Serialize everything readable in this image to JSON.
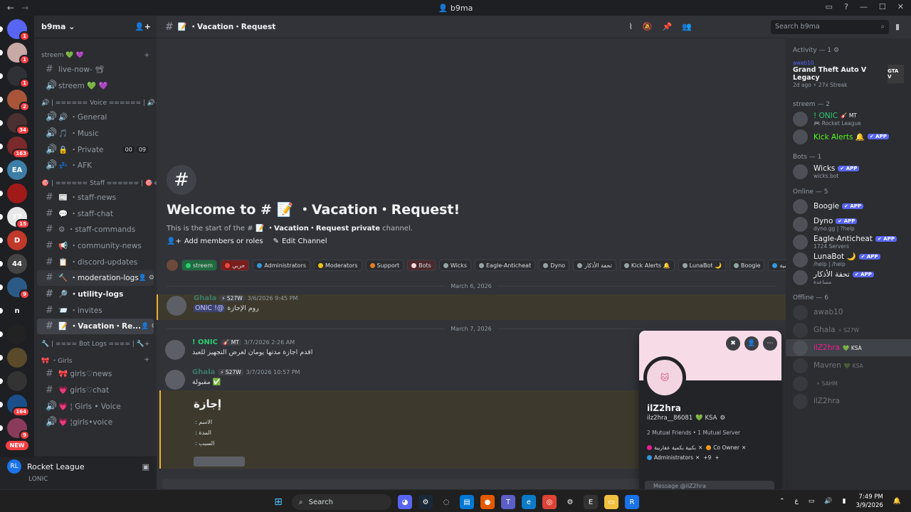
{
  "window": {
    "title": "b9ma",
    "nav_back": "←",
    "nav_forward": "→"
  },
  "servers": [
    {
      "label": "",
      "badge": "1",
      "color": "#5865f2"
    },
    {
      "label": "",
      "badge": "1",
      "color": "#c9a9a6"
    },
    {
      "label": "",
      "badge": "1",
      "color": "#2f3136"
    },
    {
      "label": "",
      "badge": "2",
      "color": "#a8553a"
    },
    {
      "label": "",
      "badge": "34",
      "color": "#4a3030"
    },
    {
      "label": "",
      "badge": "163",
      "color": "#7a2a2a"
    },
    {
      "label": "EA",
      "badge": "",
      "color": "#3d7ea6"
    },
    {
      "label": "",
      "badge": "",
      "color": "#a01a1a"
    },
    {
      "label": "77",
      "badge": "15",
      "color": "#e8e8e8"
    },
    {
      "label": "D",
      "badge": "",
      "color": "#c0392b"
    },
    {
      "label": "44",
      "badge": "",
      "color": "#444"
    },
    {
      "label": "",
      "badge": "9",
      "color": "#2c5a87"
    },
    {
      "label": "n",
      "badge": "",
      "color": "#1e1f22"
    },
    {
      "label": "",
      "badge": "",
      "color": "#222"
    },
    {
      "label": "",
      "badge": "",
      "color": "#5a4a2a"
    },
    {
      "label": "",
      "badge": "",
      "color": "#333"
    },
    {
      "label": "",
      "badge": "164",
      "color": "#1a4f8a"
    },
    {
      "label": "",
      "badge": "9",
      "color": "#8a3a5a"
    }
  ],
  "new_tag": "NEW",
  "guild": {
    "name": "b9ma"
  },
  "categories": {
    "streem": "streem 💚 💜",
    "voice": "🔊 | ====== Voice ====== | 🔊",
    "staff": "🎯 | ====== Staff ====== | 🎯",
    "botlogs": "🔧 | ==== Bot Logs ==== | 🔧",
    "girls": "🎀 ・Girls"
  },
  "channels": {
    "streem": [
      {
        "name": "live-now- 📽",
        "type": "text"
      },
      {
        "name": "streem 💚 💜",
        "type": "voice"
      }
    ],
    "voice": [
      {
        "name": "🔊 ・General",
        "type": "voice"
      },
      {
        "name": "🎵 ・Music",
        "type": "voice"
      },
      {
        "name": "🔒 ・Private",
        "type": "voice",
        "count1": "00",
        "count2": "09"
      },
      {
        "name": "💤 ・AFK",
        "type": "voice"
      }
    ],
    "staff": [
      {
        "name": "📰 ・staff-news",
        "type": "text"
      },
      {
        "name": "💬 ・staff-chat",
        "type": "text"
      },
      {
        "name": "⚙ ・staff-commands",
        "type": "text"
      },
      {
        "name": "📢 ・community-news",
        "type": "text"
      },
      {
        "name": "📋 ・discord-updates",
        "type": "text"
      },
      {
        "name": "🔨 ・moderation-logs",
        "type": "text",
        "state": "hover"
      },
      {
        "name": "🔎 ・utility-logs",
        "type": "text",
        "state": "unread"
      },
      {
        "name": "📨 ・invites",
        "type": "text"
      },
      {
        "name": "📝 ・Vacation・Re...",
        "type": "text",
        "state": "active"
      }
    ],
    "girls": [
      {
        "name": "🎀 girls♡news",
        "type": "text"
      },
      {
        "name": "💗 girls♡chat",
        "type": "text"
      },
      {
        "name": "💗 ¦ Girls • Voice",
        "type": "voice"
      },
      {
        "name": "💗 ¦girls•voice",
        "type": "voice"
      }
    ]
  },
  "user_panel": {
    "activity": "Rocket League",
    "next": "LONIC"
  },
  "header": {
    "channel": "📝 ・Vacation・Request",
    "search_placeholder": "Search b9ma"
  },
  "welcome": {
    "title": "Welcome to # 📝 ・Vacation・Request!",
    "sub_prefix": "This is the start of the #",
    "sub_channel": " 📝 ・Vacation・Request",
    "sub_suffix": " private",
    "sub_end": " channel.",
    "add_members": "Add members or roles",
    "edit_channel": "Edit Channel"
  },
  "roles": [
    {
      "name": "streem",
      "color": "#2ecc71",
      "bg": "#1f6b3e"
    },
    {
      "name": "حربي",
      "color": "#e74c3c",
      "bg": "#7a1e1e"
    },
    {
      "name": "Administrators",
      "color": "#3498db",
      "bg": "#2b2d31"
    },
    {
      "name": "Moderators",
      "color": "#f1c40f",
      "bg": "#2b2d31"
    },
    {
      "name": "Support",
      "color": "#e67e22",
      "bg": "#2b2d31"
    },
    {
      "name": "Bots",
      "color": "#f8d7da",
      "bg": "#4a2a2e"
    },
    {
      "name": "Wicks",
      "color": "#95a5a6",
      "bg": "#2b2d31"
    },
    {
      "name": "Eagle-Anticheat",
      "color": "#95a5a6",
      "bg": "#2b2d31"
    },
    {
      "name": "Dyno",
      "color": "#95a5a6",
      "bg": "#2b2d31"
    },
    {
      "name": "تحفة الأذكار",
      "color": "#95a5a6",
      "bg": "#2b2d31"
    },
    {
      "name": "Kick Alerts 🔔",
      "color": "#95a5a6",
      "bg": "#2b2d31"
    },
    {
      "name": "LunaBot 🌙",
      "color": "#95a5a6",
      "bg": "#2b2d31"
    },
    {
      "name": "Boogie",
      "color": "#95a5a6",
      "bg": "#2b2d31"
    },
    {
      "name": "الهاشمية",
      "color": "#3498db",
      "bg": "#2b2d31"
    }
  ],
  "dates": {
    "d1": "March 6, 2026",
    "d2": "March 7, 2026"
  },
  "messages": [
    {
      "author": "Ghala",
      "color": "#3b7a6b",
      "tag": "⚡ S27W",
      "time": "3/6/2026 9:45 PM",
      "text": "روم الإجازة",
      "mention": "@! ONIC"
    },
    {
      "author": "! ONIC",
      "color": "#2ecc71",
      "tag": "🎸 MT",
      "time": "3/7/2026 2:26 AM",
      "text": "اقدم اجازة مدتها يومان لغرض التجهيز للعيد"
    },
    {
      "author": "Ghala",
      "color": "#3b7a6b",
      "tag": "⚡ S27W",
      "time": "3/7/2026 10:57 PM",
      "text": "✅ مقبولة"
    }
  ],
  "embed": {
    "heading": "إجازة",
    "line1": ": الاسم",
    "line2": ": المدة",
    "line3": ": السبب"
  },
  "member_list": {
    "activity_title": "Activity — 1 ⚙",
    "activity": {
      "user": "awab10",
      "game": "Grand Theft Auto V Legacy",
      "meta1": "2d ago",
      "meta2": "⚡ 27x Streak",
      "logo": "GTA V"
    },
    "streem_title": "streem — 2",
    "streem": [
      {
        "name": "! ONIC",
        "badge": "🎸 MT",
        "sub": "🎮 Rocket League",
        "color": "#2ecc71"
      },
      {
        "name": "Kick Alerts 🔔",
        "app": "✔ APP",
        "color": "#53fc18"
      }
    ],
    "bots_title": "Bots — 1",
    "bots": [
      {
        "name": "Wicks",
        "app": "✔ APP",
        "sub": "wicks.bot"
      }
    ],
    "online_title": "Online — 5",
    "online": [
      {
        "name": "Boogie",
        "app": "✔ APP",
        "sub": ""
      },
      {
        "name": "Dyno",
        "app": "✔ APP",
        "sub": "dyno.gg | ?help"
      },
      {
        "name": "Eagle-Anticheat",
        "app": "✔ APP",
        "sub": "1724 Servers"
      },
      {
        "name": "LunaBot 🌙",
        "app": "✔ APP",
        "sub": "/help | /help"
      },
      {
        "name": "تحفة الأذكار",
        "app": "✔ APP",
        "sub": "مساعدة"
      }
    ],
    "offline_title": "Offline — 6",
    "offline": [
      {
        "name": "awab10",
        "badge": ""
      },
      {
        "name": "Ghala",
        "badge": "⚡ S27W"
      },
      {
        "name": "ilZ2hra",
        "badge": "💚 KSA",
        "color": "#e91e8c",
        "selected": true
      },
      {
        "name": "Mavren",
        "badge": "💚 KSA"
      },
      {
        "name": "",
        "badge": "⚡ SAHM"
      },
      {
        "name": "ilZ2hra",
        "badge": ""
      }
    ]
  },
  "popout": {
    "name": "ilZ2hra",
    "username": "ilz2hra__86081",
    "badge": "💚 KSA",
    "mutual": "2 Mutual Friends • 1 Mutual Server",
    "roles": [
      {
        "name": "بكبية بكمية عفاريبة",
        "color": "#e91e8c"
      },
      {
        "name": "Co Owner",
        "color": "#f39c12"
      },
      {
        "name": "Administrators",
        "color": "#3498db"
      }
    ],
    "more": "+9",
    "add": "+",
    "message_placeholder": "Message @ilZ2hra"
  },
  "taskbar": {
    "search": "Search",
    "time": "7:49 PM",
    "date": "3/9/2026",
    "lang": "ع"
  }
}
